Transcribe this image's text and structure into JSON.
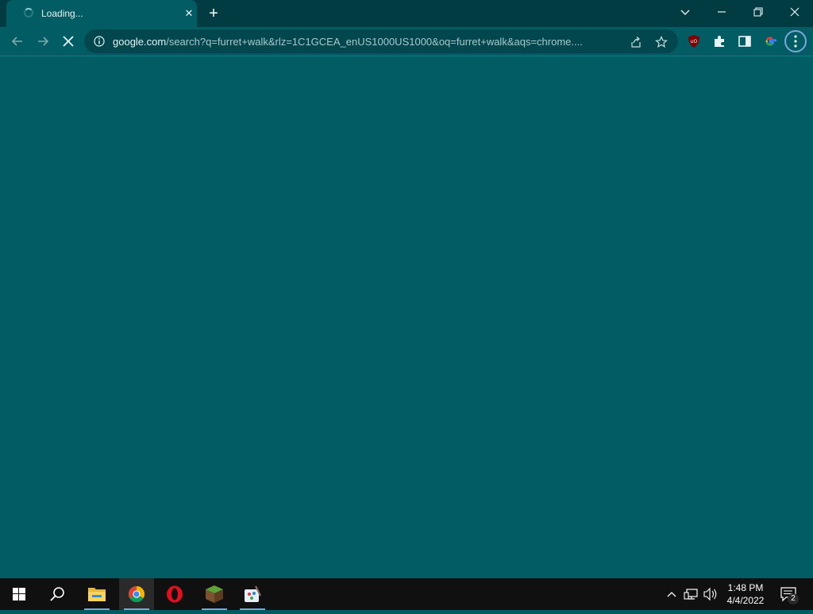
{
  "browser": {
    "tab": {
      "title": "Loading..."
    },
    "address_bar": {
      "url_domain": "google.com",
      "url_rest": "/search?q=furret+walk&rlz=1C1GCEA_enUS1000US1000&oq=furret+walk&aqs=chrome...."
    },
    "icons": {
      "back": "arrow-left-icon",
      "forward": "arrow-right-icon",
      "stop": "close-icon",
      "site_info": "info-icon",
      "share": "share-icon",
      "bookmark": "star-icon",
      "ublock": "ublock-icon",
      "extensions": "puzzle-icon",
      "side_panel": "side-panel-icon",
      "google": "google-icon",
      "menu": "kebab-menu-icon"
    }
  },
  "taskbar": {
    "clock": {
      "time": "1:48 PM",
      "date": "4/4/2022"
    },
    "notifications": {
      "count": "2"
    },
    "apps": [
      "windows-start-icon",
      "search-icon",
      "file-explorer-icon",
      "chrome-icon",
      "opera-icon",
      "minecraft-icon",
      "paint-icon"
    ]
  },
  "colors": {
    "titlebar": "#013c42",
    "tab_active": "#015d63",
    "page_bg": "#015d63",
    "omnibox": "#01474d",
    "taskbar": "#101010"
  }
}
